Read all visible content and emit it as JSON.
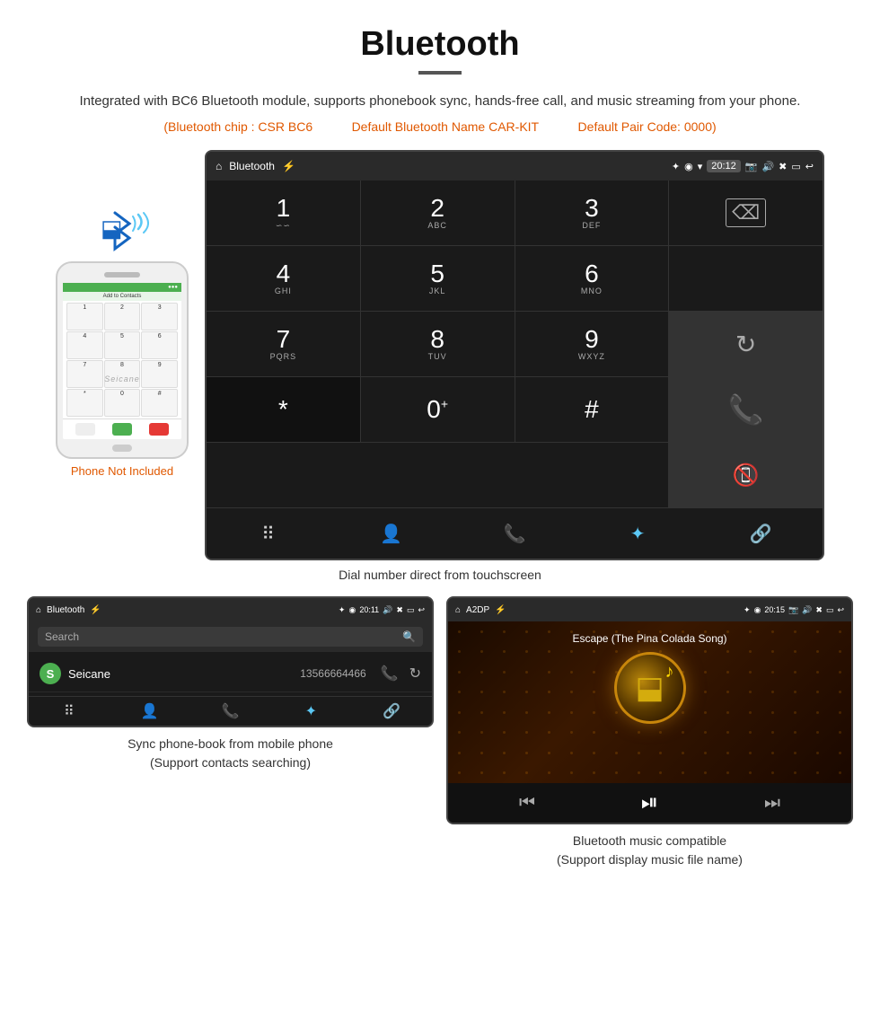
{
  "page": {
    "title": "Bluetooth",
    "description": "Integrated with BC6 Bluetooth module, supports phonebook sync, hands-free call, and music streaming from your phone.",
    "specs": [
      "(Bluetooth chip : CSR BC6",
      "Default Bluetooth Name CAR-KIT",
      "Default Pair Code: 0000)"
    ],
    "dial_caption": "Dial number direct from touchscreen",
    "phonebook_caption": "Sync phone-book from mobile phone\n(Support contacts searching)",
    "music_caption": "Bluetooth music compatible\n(Support display music file name)",
    "phone_not_included": "Phone Not Included"
  },
  "dial_screen": {
    "statusbar": {
      "app_name": "Bluetooth",
      "time": "20:12"
    },
    "keys": [
      {
        "num": "1",
        "sub": "∽∽"
      },
      {
        "num": "2",
        "sub": "ABC"
      },
      {
        "num": "3",
        "sub": "DEF"
      },
      {
        "num": "",
        "sub": ""
      },
      {
        "num": "4",
        "sub": "GHI"
      },
      {
        "num": "5",
        "sub": "JKL"
      },
      {
        "num": "6",
        "sub": "MNO"
      },
      {
        "num": "",
        "sub": ""
      },
      {
        "num": "7",
        "sub": "PQRS"
      },
      {
        "num": "8",
        "sub": "TUV"
      },
      {
        "num": "9",
        "sub": "WXYZ"
      },
      {
        "num": "",
        "sub": ""
      },
      {
        "num": "*",
        "sub": ""
      },
      {
        "num": "0",
        "sup": "+"
      },
      {
        "num": "#",
        "sub": ""
      },
      {
        "num": "",
        "sub": ""
      }
    ]
  },
  "phonebook_screen": {
    "statusbar": {
      "app_name": "Bluetooth",
      "time": "20:11"
    },
    "search_placeholder": "Search",
    "contacts": [
      {
        "letter": "S",
        "name": "Seicane",
        "number": "13566664466"
      }
    ]
  },
  "music_screen": {
    "statusbar": {
      "app_name": "A2DP",
      "time": "20:15"
    },
    "song_title": "Escape (The Pina Colada Song)"
  }
}
